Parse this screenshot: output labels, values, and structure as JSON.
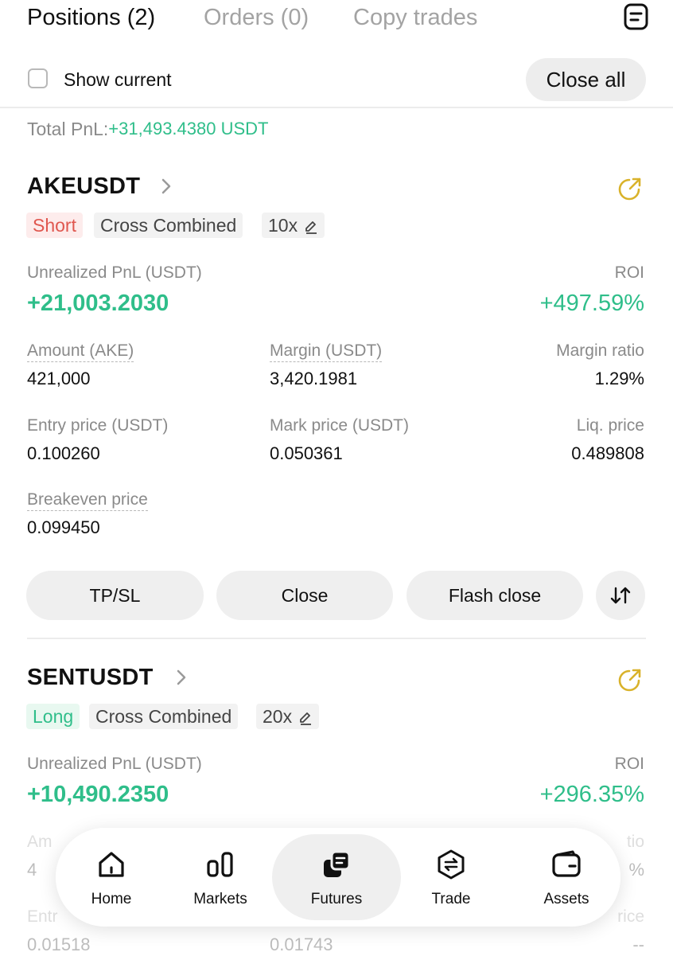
{
  "tabs": [
    {
      "label": "Positions (2)",
      "active": true
    },
    {
      "label": "Orders (0)",
      "active": false
    },
    {
      "label": "Copy trades",
      "active": false
    }
  ],
  "filter": {
    "show_current_label": "Show current",
    "close_all_label": "Close all"
  },
  "total_pnl": {
    "label": "Total PnL: ",
    "value": "+31,493.4380 USDT"
  },
  "positions": [
    {
      "symbol": "AKEUSDT",
      "side": "Short",
      "mode": "Cross  Combined",
      "leverage": "10x",
      "unrealized_pnl_label": "Unrealized PnL (USDT)",
      "unrealized_pnl": "+21,003.2030",
      "roi_label": "ROI",
      "roi": "+497.59%",
      "amount_label": "Amount (AKE)",
      "amount": "421,000",
      "margin_label": "Margin (USDT)",
      "margin": "3,420.1981",
      "margin_ratio_label": "Margin ratio",
      "margin_ratio": "1.29%",
      "entry_price_label": "Entry price (USDT)",
      "entry_price": "0.100260",
      "mark_price_label": "Mark price (USDT)",
      "mark_price": "0.050361",
      "liq_price_label": "Liq. price",
      "liq_price": "0.489808",
      "breakeven_label": "Breakeven price",
      "breakeven": "0.099450",
      "buttons": {
        "tpsl": "TP/SL",
        "close": "Close",
        "flash_close": "Flash close"
      }
    },
    {
      "symbol": "SENTUSDT",
      "side": "Long",
      "mode": "Cross  Combined",
      "leverage": "20x",
      "unrealized_pnl_label": "Unrealized PnL (USDT)",
      "unrealized_pnl": "+10,490.2350",
      "roi_label": "ROI",
      "roi": "+296.35%",
      "partial": {
        "amount_label_fragment": "Am",
        "amount_fragment": "4",
        "margin_ratio_label_fragment": "tio",
        "margin_ratio_fragment": "%",
        "entry_label_fragment": "Entr",
        "liq_label_fragment": "rice",
        "entry_price": "0.01518",
        "mark_price": "0.01743",
        "liq_price": "--"
      }
    }
  ],
  "nav": [
    {
      "label": "Home",
      "icon": "home-icon",
      "active": false
    },
    {
      "label": "Markets",
      "icon": "markets-icon",
      "active": false
    },
    {
      "label": "Futures",
      "icon": "futures-icon",
      "active": true
    },
    {
      "label": "Trade",
      "icon": "trade-icon",
      "active": false
    },
    {
      "label": "Assets",
      "icon": "assets-icon",
      "active": false
    }
  ],
  "colors": {
    "profit_green": "#2fbe8a",
    "short_red": "#e0574f",
    "share_yellow": "#d9b22a",
    "text": "#111111",
    "muted": "#8a8a8a"
  }
}
